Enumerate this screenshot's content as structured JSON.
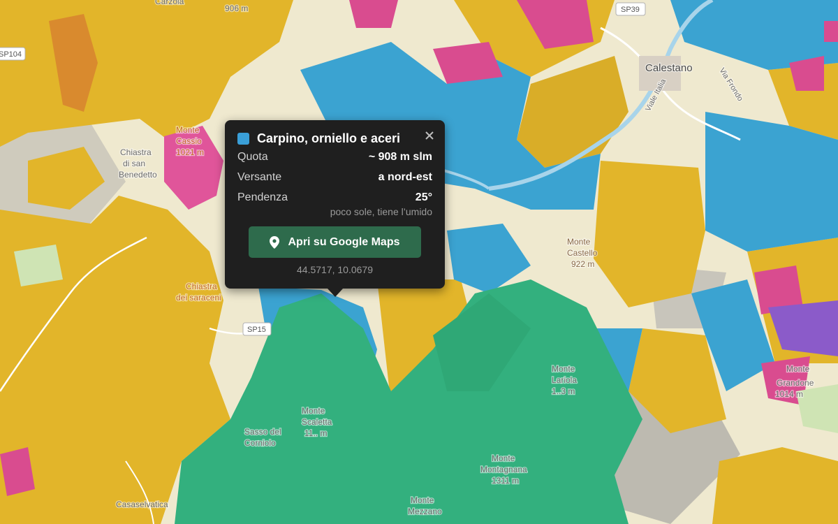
{
  "map": {
    "labels": {
      "calestano": "Calestano",
      "chiastra_san_benedetto": [
        "Chiastra",
        "di san",
        "Benedetto"
      ],
      "monte_cassio": [
        "Monte",
        "Cassio",
        "1021 m"
      ],
      "monte_castello": [
        "Monte",
        "Castello",
        "922 m"
      ],
      "chiastra_saraceni": [
        "Chiastra",
        "dei saraceni"
      ],
      "monte_scaletta": [
        "Monte",
        "Scaletta",
        "11.. m"
      ],
      "sasso_del_corniolo": [
        "Sasso del",
        "Corniolo"
      ],
      "monte_lariola": [
        "Monte",
        "Lariola",
        "1..3 m"
      ],
      "monte_montagnana": [
        "Monte",
        "Montagnana",
        "1311 m"
      ],
      "monte_mezzano": [
        "Monte",
        "Mezzano"
      ],
      "monte_grandone": [
        "Monte",
        "Grandone",
        "1014 m"
      ],
      "casaselvatica": "Casaselvatica",
      "viale_italia": "Viale Italia",
      "via_frondo": "Via Frondo",
      "top_elev": "906 m",
      "top_place": "Carzola"
    },
    "roads": [
      "SP39",
      "SP15",
      "SP104"
    ]
  },
  "popup": {
    "swatch_color": "#3a9fd8",
    "title": "Carpino, orniello e aceri",
    "rows": [
      {
        "label": "Quota",
        "value": "~ 908 m slm"
      },
      {
        "label": "Versante",
        "value": "a nord-est"
      },
      {
        "label": "Pendenza",
        "value": "25°"
      }
    ],
    "hint": "poco sole, tiene l’umido",
    "button_label": "Apri su Google Maps",
    "coords": "44.5717, 10.0679"
  }
}
